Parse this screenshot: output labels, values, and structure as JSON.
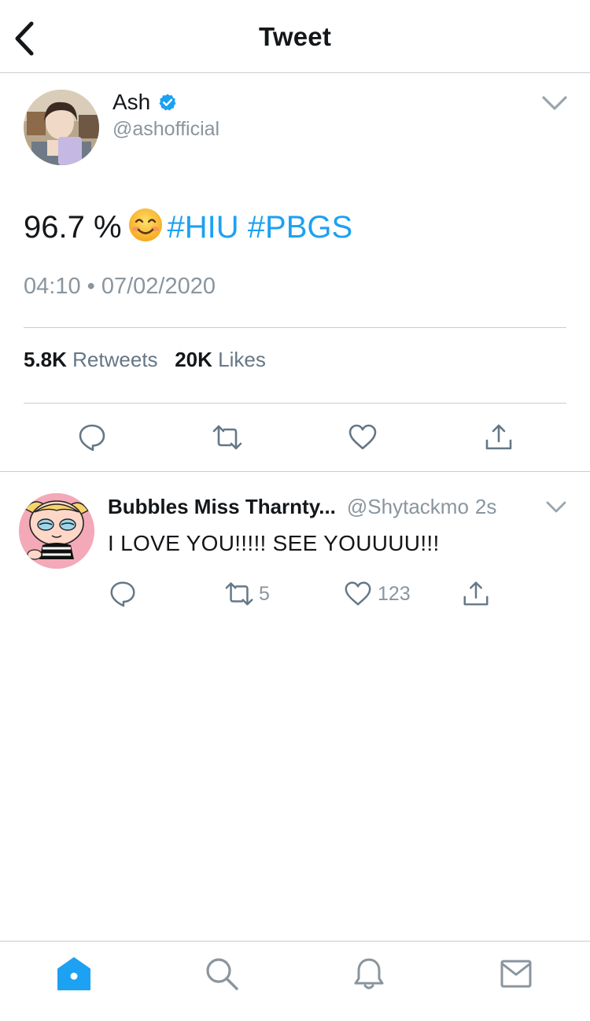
{
  "header": {
    "title": "Tweet",
    "back_icon": "chevron-left-icon"
  },
  "tweet": {
    "author_name": "Ash",
    "author_handle": "@ashofficial",
    "text": "96.7 %",
    "emoji": "smiling-face-emoji",
    "hashtags": [
      "#HIU",
      "#PBGS"
    ],
    "timestamp": "04:10 • 07/02/2020",
    "retweets_count": "5.8K",
    "retweets_label": "Retweets",
    "likes_count": "20K",
    "likes_label": "Likes"
  },
  "reply": {
    "author_name": "Bubbles Miss Tharnty...",
    "author_handle": "@Shytackmo",
    "time": "2s",
    "text": "I LOVE YOU!!!!! SEE YOUUUU!!!",
    "retweets": "5",
    "likes": "123"
  },
  "tabbar": {
    "items": [
      "home-icon",
      "search-icon",
      "bell-icon",
      "mail-icon"
    ],
    "active": "home-icon"
  },
  "colors": {
    "accent": "#1da1f2",
    "text": "#14171a",
    "secondary": "#8a959e",
    "divider": "#c8cdd1",
    "verified": "#1da1f2"
  }
}
